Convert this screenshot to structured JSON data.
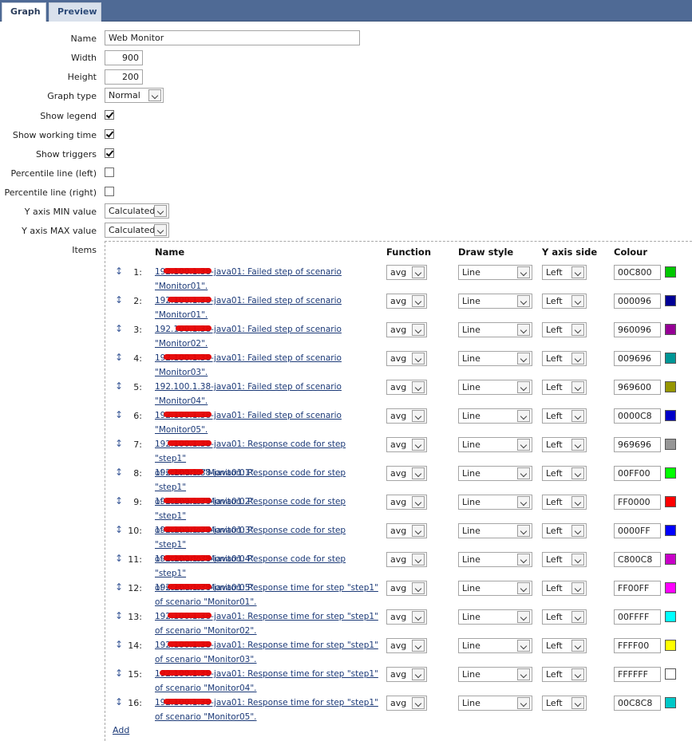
{
  "tabs": [
    {
      "label": "Graph",
      "active": true
    },
    {
      "label": "Preview",
      "active": false
    }
  ],
  "form": {
    "name_label": "Name",
    "name_value": "Web Monitor",
    "width_label": "Width",
    "width_value": "900",
    "height_label": "Height",
    "height_value": "200",
    "graph_type_label": "Graph type",
    "graph_type_value": "Normal",
    "show_legend_label": "Show legend",
    "show_legend": true,
    "show_working_time_label": "Show working time",
    "show_working_time": true,
    "show_triggers_label": "Show triggers",
    "show_triggers": true,
    "percentile_left_label": "Percentile line (left)",
    "percentile_left": false,
    "percentile_right_label": "Percentile line (right)",
    "percentile_right": false,
    "y_min_label": "Y axis MIN value",
    "y_min_value": "Calculated",
    "y_max_label": "Y axis MAX value",
    "y_max_value": "Calculated",
    "items_label": "Items"
  },
  "items_table": {
    "headers": {
      "name": "Name",
      "function": "Function",
      "draw_style": "Draw style",
      "y_axis_side": "Y axis side",
      "colour": "Colour"
    },
    "rows": [
      {
        "index": "1:",
        "line1": "192.100.1.38-java01: Failed step of scenario",
        "line2": "\"Monitor01\".",
        "function": "avg",
        "draw_style": "Line",
        "y_axis_side": "Left",
        "colour": "00C800",
        "colour_hex": "#00C800"
      },
      {
        "index": "2:",
        "line1": "192.100.1.38-java01: Failed step of scenario",
        "line2": "\"Monitor01\".",
        "function": "avg",
        "draw_style": "Line",
        "y_axis_side": "Left",
        "colour": "000096",
        "colour_hex": "#000096"
      },
      {
        "index": "3:",
        "line1": "192.100.1.38-java01: Failed step of scenario",
        "line2": "\"Monitor02\".",
        "function": "avg",
        "draw_style": "Line",
        "y_axis_side": "Left",
        "colour": "960096",
        "colour_hex": "#960096"
      },
      {
        "index": "4:",
        "line1": "192.100.1.38-java01: Failed step of scenario",
        "line2": "\"Monitor03\".",
        "function": "avg",
        "draw_style": "Line",
        "y_axis_side": "Left",
        "colour": "009696",
        "colour_hex": "#009696"
      },
      {
        "index": "5:",
        "line1": "192.100.1.38-java01: Failed step of scenario",
        "line2": "\"Monitor04\".",
        "function": "avg",
        "draw_style": "Line",
        "y_axis_side": "Left",
        "colour": "969600",
        "colour_hex": "#969600"
      },
      {
        "index": "6:",
        "line1": "192.100.1.38-java01: Failed step of scenario",
        "line2": "\"Monitor05\".",
        "function": "avg",
        "draw_style": "Line",
        "y_axis_side": "Left",
        "colour": "0000C8",
        "colour_hex": "#0000C8"
      },
      {
        "index": "7:",
        "line1": "192.100.1.38-java01: Response code for step \"step1\"",
        "line2": "of scenario \"Monitor01\".",
        "function": "avg",
        "draw_style": "Line",
        "y_axis_side": "Left",
        "colour": "969696",
        "colour_hex": "#969696"
      },
      {
        "index": "8:",
        "line1": "192.100.1.38-java01: Response code for step \"step1\"",
        "line2": "of scenario \"Monitor02\".",
        "function": "avg",
        "draw_style": "Line",
        "y_axis_side": "Left",
        "colour": "00FF00",
        "colour_hex": "#00FF00"
      },
      {
        "index": "9:",
        "line1": "192.100.1.38-java01: Response code for step \"step1\"",
        "line2": "of scenario \"Monitor03\".",
        "function": "avg",
        "draw_style": "Line",
        "y_axis_side": "Left",
        "colour": "FF0000",
        "colour_hex": "#FF0000"
      },
      {
        "index": "10:",
        "line1": "192.100.1.38-java01: Response code for step \"step1\"",
        "line2": "of scenario \"Monitor04\".",
        "function": "avg",
        "draw_style": "Line",
        "y_axis_side": "Left",
        "colour": "0000FF",
        "colour_hex": "#0000FF"
      },
      {
        "index": "11:",
        "line1": "192.100.1.38-java01: Response code for step \"step1\"",
        "line2": "of scenario \"Monitor05\".",
        "function": "avg",
        "draw_style": "Line",
        "y_axis_side": "Left",
        "colour": "C800C8",
        "colour_hex": "#C800C8"
      },
      {
        "index": "12:",
        "line1": "192.100.1.38-java01: Response time for step \"step1\"",
        "line2": "of scenario \"Monitor01\".",
        "function": "avg",
        "draw_style": "Line",
        "y_axis_side": "Left",
        "colour": "FF00FF",
        "colour_hex": "#FF00FF"
      },
      {
        "index": "13:",
        "line1": "192.100.1.38-java01: Response time for step \"step1\"",
        "line2": "of scenario \"Monitor02\".",
        "function": "avg",
        "draw_style": "Line",
        "y_axis_side": "Left",
        "colour": "00FFFF",
        "colour_hex": "#00FFFF"
      },
      {
        "index": "14:",
        "line1": "192.100.1.38-java01: Response time for step \"step1\"",
        "line2": "of scenario \"Monitor03\".",
        "function": "avg",
        "draw_style": "Line",
        "y_axis_side": "Left",
        "colour": "FFFF00",
        "colour_hex": "#FFFF00"
      },
      {
        "index": "15:",
        "line1": "192.100.1.38-java01: Response time for step \"step1\"",
        "line2": "of scenario \"Monitor04\".",
        "function": "avg",
        "draw_style": "Line",
        "y_axis_side": "Left",
        "colour": "FFFFFF",
        "colour_hex": "#FFFFFF"
      },
      {
        "index": "16:",
        "line1": "192.100.1.38-java01: Response time for step \"step1\"",
        "line2": "of scenario \"Monitor05\".",
        "function": "avg",
        "draw_style": "Line",
        "y_axis_side": "Left",
        "colour": "00C8C8",
        "colour_hex": "#00C8C8"
      }
    ],
    "add_label": "Add"
  },
  "icons": {
    "drag": "drag-handle-icon",
    "dropdown": "chevron-down-icon"
  }
}
